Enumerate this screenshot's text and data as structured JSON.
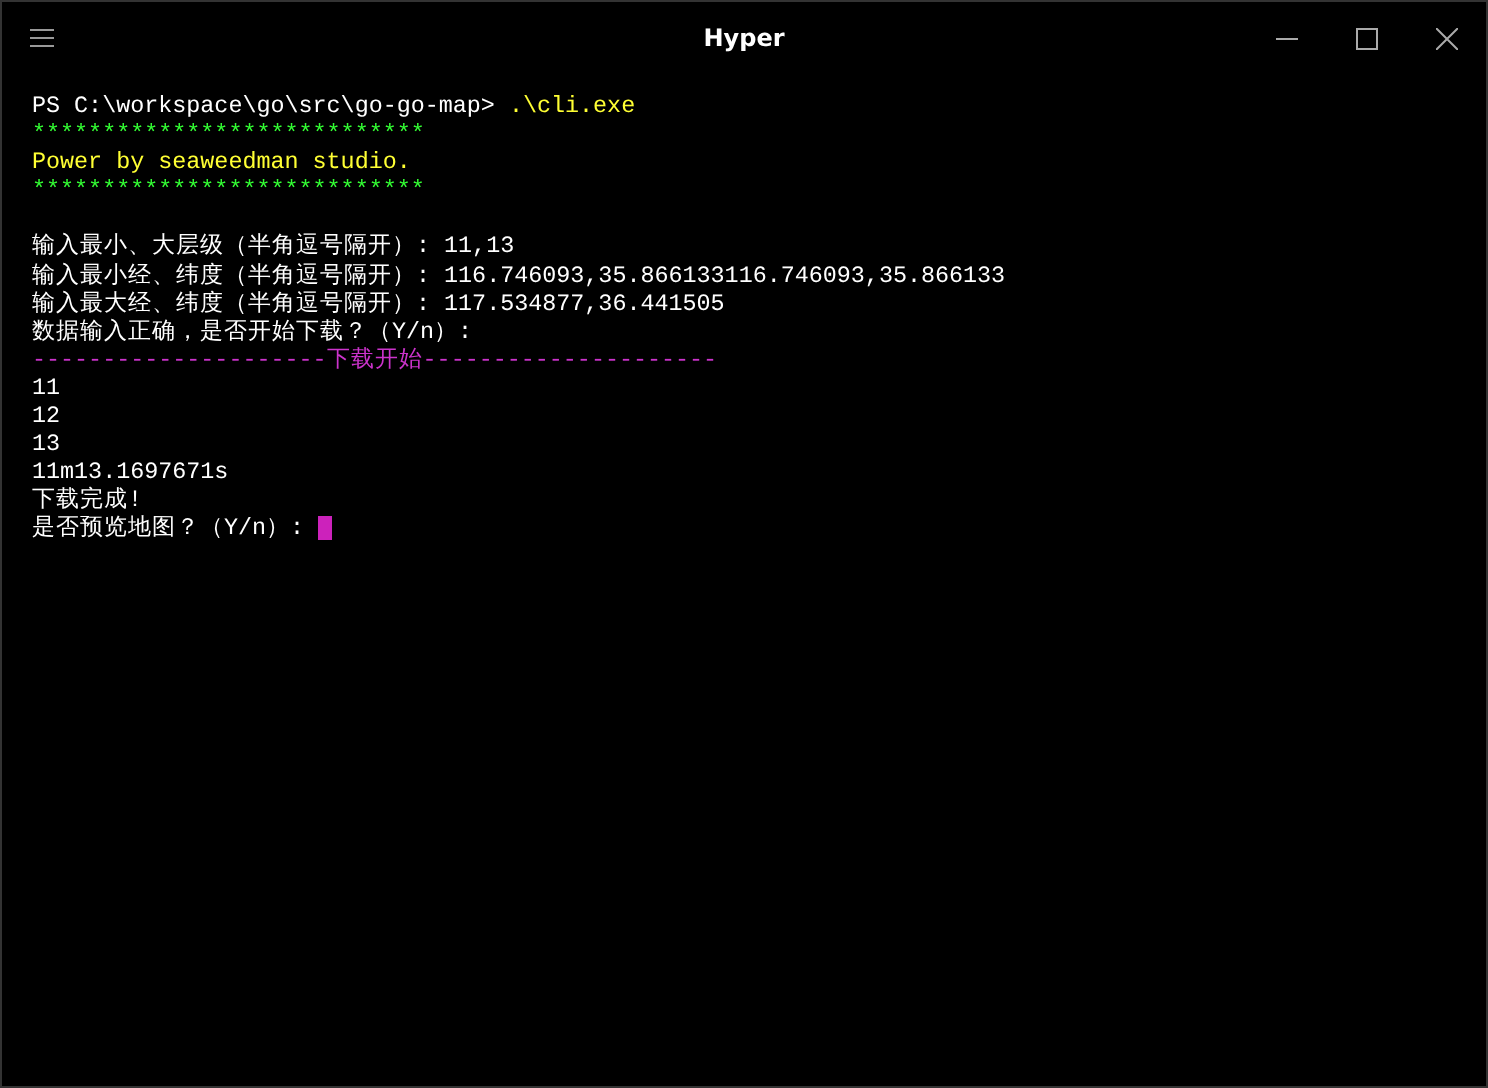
{
  "window": {
    "title": "Hyper"
  },
  "lines": [
    {
      "segments": [
        {
          "text": "PS C:\\workspace\\go\\src\\go-go-map>",
          "color": "#ffffff"
        },
        {
          "text": " .\\cli.exe",
          "color": "#ffff33"
        }
      ]
    },
    {
      "segments": [
        {
          "text": "****************************",
          "color": "#33ff33"
        }
      ]
    },
    {
      "segments": [
        {
          "text": "Power by seaweedman studio.",
          "color": "#ffff33"
        }
      ]
    },
    {
      "segments": [
        {
          "text": "****************************",
          "color": "#33ff33"
        }
      ]
    },
    {
      "blank_line_before": true,
      "segments": [
        {
          "text": "输入最小、大层级（半角逗号隔开）: 11,13",
          "color": "#ffffff"
        }
      ]
    },
    {
      "segments": [
        {
          "text": "输入最小经、纬度（半角逗号隔开）: 116.746093,35.866133116.746093,35.866133",
          "color": "#ffffff"
        }
      ]
    },
    {
      "segments": [
        {
          "text": "输入最大经、纬度（半角逗号隔开）: 117.534877,36.441505",
          "color": "#ffffff"
        }
      ]
    },
    {
      "segments": [
        {
          "text": "数据输入正确，是否开始下载？（Y/n）:",
          "color": "#ffffff"
        }
      ]
    },
    {
      "segments": [
        {
          "text": "---------------------下载开始---------------------",
          "color": "#cc33cc"
        }
      ]
    },
    {
      "segments": [
        {
          "text": "11",
          "color": "#ffffff"
        }
      ]
    },
    {
      "segments": [
        {
          "text": "12",
          "color": "#ffffff"
        }
      ]
    },
    {
      "segments": [
        {
          "text": "13",
          "color": "#ffffff"
        }
      ]
    },
    {
      "segments": [
        {
          "text": "11m13.1697671s",
          "color": "#ffffff"
        }
      ]
    },
    {
      "segments": [
        {
          "text": "下载完成!",
          "color": "#ffffff"
        }
      ]
    },
    {
      "segments": [
        {
          "text": "是否预览地图？（Y/n）: ",
          "color": "#ffffff"
        }
      ],
      "cursor": true
    }
  ]
}
